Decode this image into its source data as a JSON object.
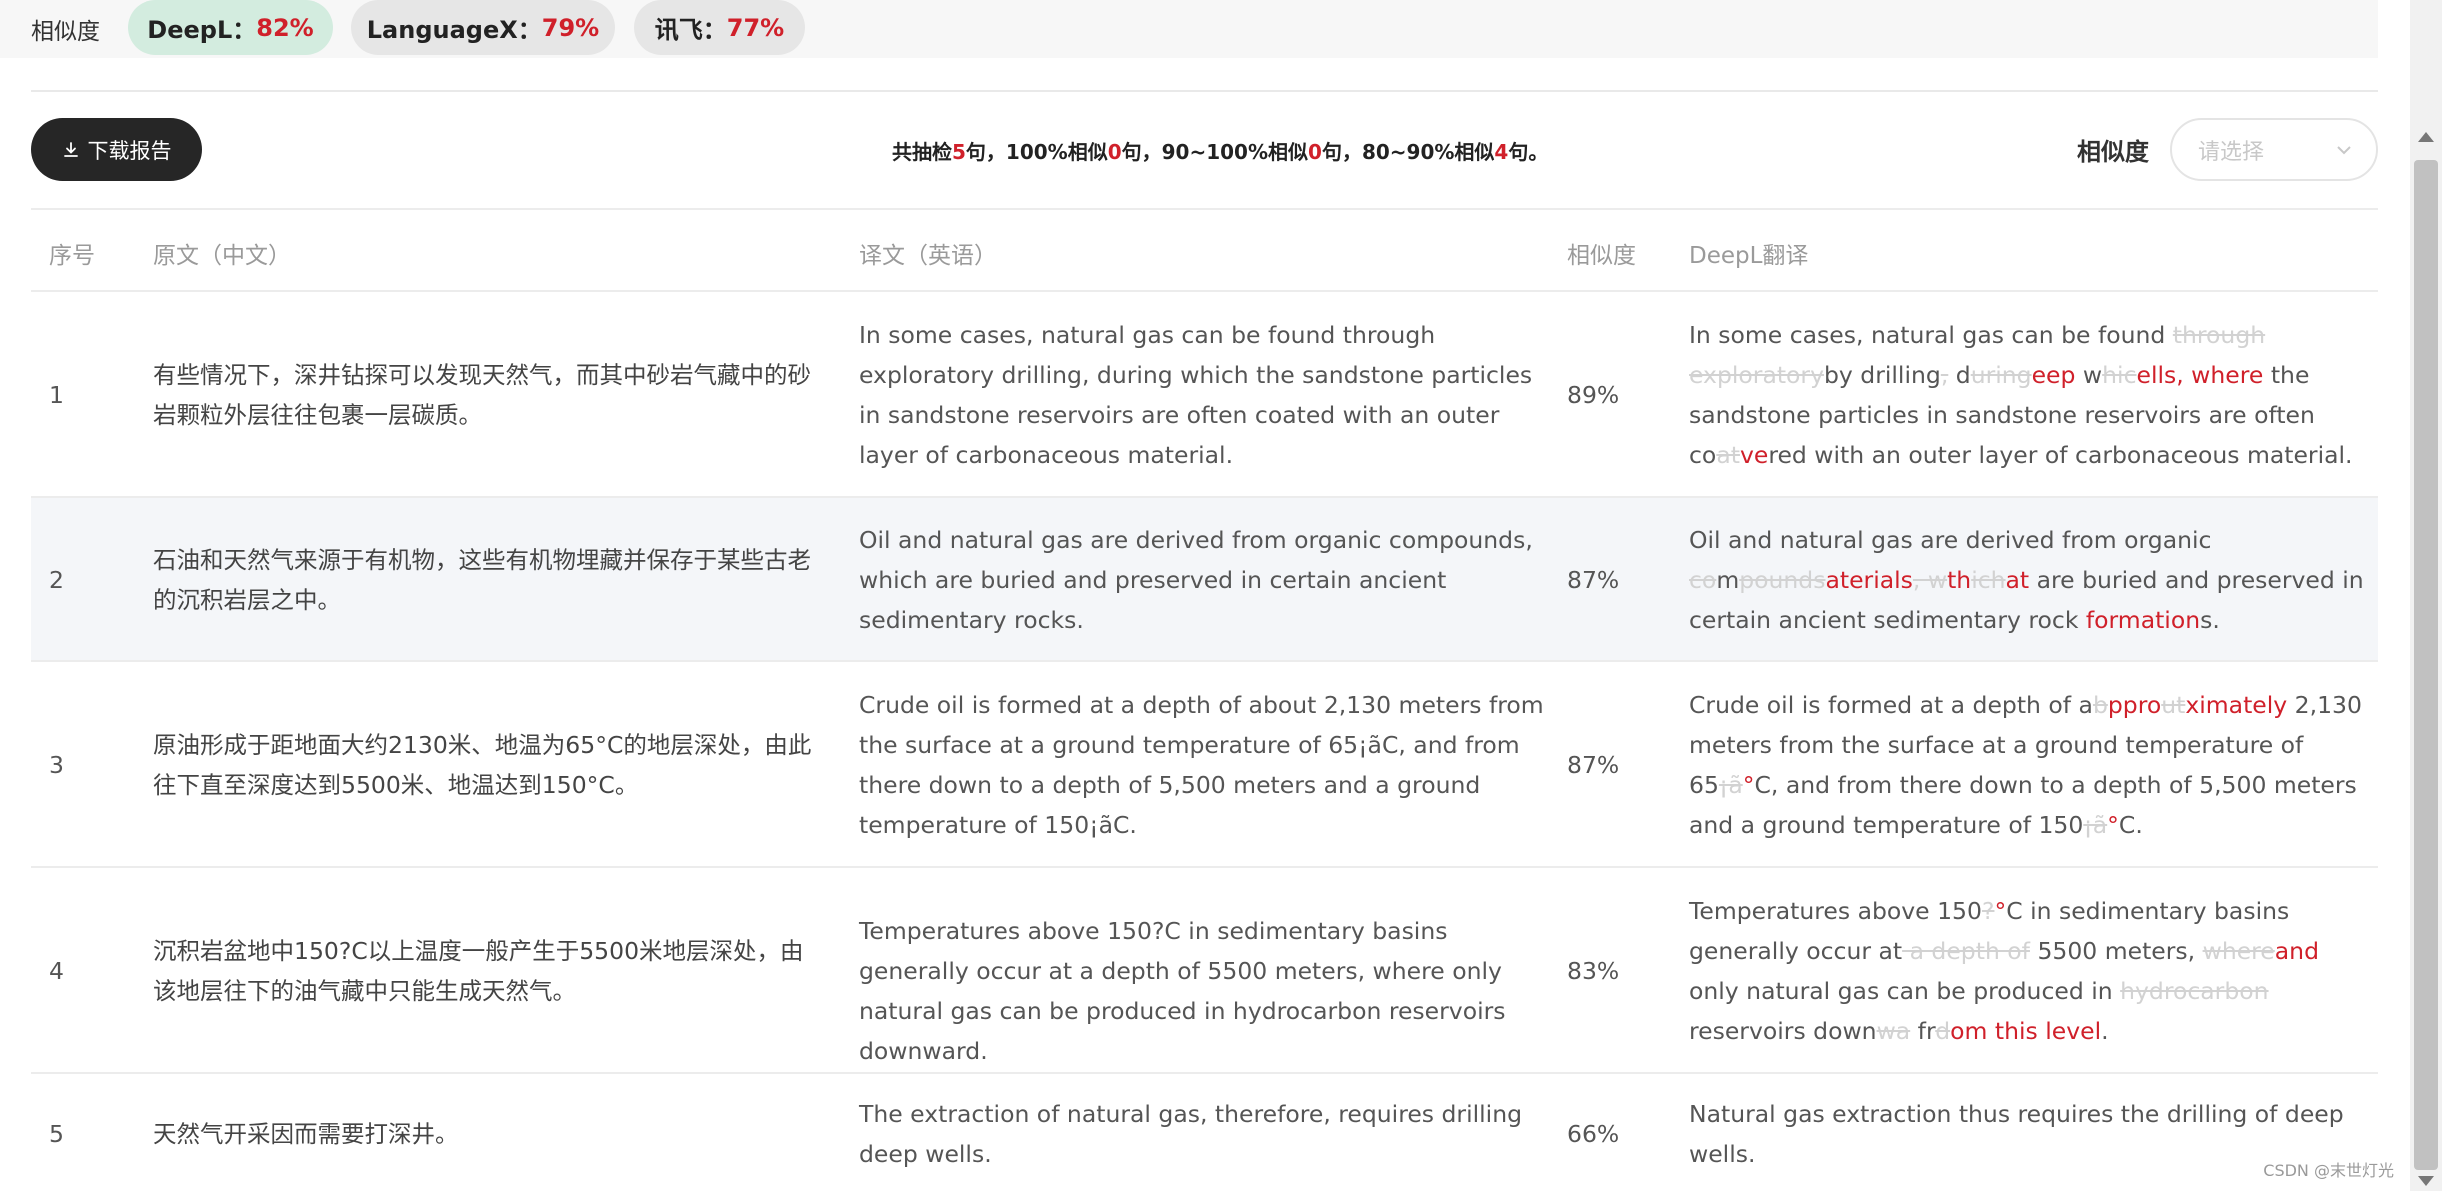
{
  "similarity_bar": {
    "label": "相似度",
    "items": [
      {
        "engine": "DeepL：",
        "value": "82%"
      },
      {
        "engine": "LanguageX：",
        "value": "79%"
      },
      {
        "engine": "讯飞：",
        "value": "77%"
      }
    ]
  },
  "toolbar": {
    "download_label": "下载报告",
    "summary": {
      "p1": "共抽检",
      "total": "5",
      "p2": "句，100%相似",
      "c100": "0",
      "p3": "句，90~100%相似",
      "c90": "0",
      "p4": "句，80~90%相似",
      "c80": "4",
      "p5": "句。"
    },
    "filter_label": "相似度",
    "filter_placeholder": "请选择"
  },
  "table": {
    "headers": {
      "num": "序号",
      "src": "原文（中文）",
      "tr": "译文（英语）",
      "sim": "相似度",
      "dl": "DeepL翻译"
    },
    "rows": [
      {
        "num": "1",
        "src": "有些情况下，深井钻探可以发现天然气，而其中砂岩气藏中的砂岩颗粒外层往往包裹一层碳质。",
        "tr": "In some cases, natural gas can be found through exploratory drilling, during which the sandstone particles in sandstone reservoirs are often coated with an outer layer of carbonaceous material.",
        "sim": "89%",
        "dl": [
          {
            "t": "In some cases, natural gas can be found ",
            "k": "n"
          },
          {
            "t": "through exploratory",
            "k": "d"
          },
          {
            "t": "by drilling",
            "k": "n"
          },
          {
            "t": ",",
            "k": "d"
          },
          {
            "t": " d",
            "k": "n"
          },
          {
            "t": "uring",
            "k": "d"
          },
          {
            "t": "eep",
            "k": "i"
          },
          {
            "t": " w",
            "k": "n"
          },
          {
            "t": "hic",
            "k": "d"
          },
          {
            "t": "ells, where",
            "k": "i"
          },
          {
            "t": " the sandstone particles in sandstone reservoirs are often co",
            "k": "n"
          },
          {
            "t": "at",
            "k": "d"
          },
          {
            "t": "ve",
            "k": "i"
          },
          {
            "t": "red with an outer layer of carbonaceous material.",
            "k": "n"
          }
        ]
      },
      {
        "num": "2",
        "src": "石油和天然气来源于有机物，这些有机物埋藏并保存于某些古老的沉积岩层之中。",
        "tr": "Oil and natural gas are derived from organic compounds, which are buried and preserved in certain ancient sedimentary rocks.",
        "sim": "87%",
        "dl": [
          {
            "t": "Oil and natural gas are derived from organic ",
            "k": "n"
          },
          {
            "t": "co",
            "k": "d"
          },
          {
            "t": "m",
            "k": "n"
          },
          {
            "t": "pounds",
            "k": "d"
          },
          {
            "t": "aterials",
            "k": "i"
          },
          {
            "t": ", w",
            "k": "d"
          },
          {
            "t": "th",
            "k": "i"
          },
          {
            "t": "ich",
            "k": "d"
          },
          {
            "t": "at",
            "k": "i"
          },
          {
            "t": " are buried and preserved in certain ancient sedimentary rock ",
            "k": "n"
          },
          {
            "t": "formation",
            "k": "i"
          },
          {
            "t": "s.",
            "k": "n"
          }
        ]
      },
      {
        "num": "3",
        "src": "原油形成于距地面大约2130米、地温为65°C的地层深处，由此往下直至深度达到5500米、地温达到150°C。",
        "tr": "Crude oil is formed at a depth of about 2,130 meters from the surface at a ground temperature of 65¡ãC, and from there down to a depth of 5,500 meters and a ground temperature of 150¡ãC.",
        "sim": "87%",
        "dl": [
          {
            "t": "Crude oil is formed at a depth of a",
            "k": "n"
          },
          {
            "t": "b",
            "k": "d"
          },
          {
            "t": "ppro",
            "k": "i"
          },
          {
            "t": "ut",
            "k": "d"
          },
          {
            "t": "ximately",
            "k": "i"
          },
          {
            "t": " 2,130 meters from the surface at a ground temperature of 65",
            "k": "n"
          },
          {
            "t": "¡ã",
            "k": "d"
          },
          {
            "t": "°",
            "k": "i"
          },
          {
            "t": "C, and from there down to a depth of 5,500 meters and a ground temperature of 150",
            "k": "n"
          },
          {
            "t": "¡ã",
            "k": "d"
          },
          {
            "t": "°",
            "k": "i"
          },
          {
            "t": "C.",
            "k": "n"
          }
        ]
      },
      {
        "num": "4",
        "src": "沉积岩盆地中150?C以上温度一般产生于5500米地层深处，由该地层往下的油气藏中只能生成天然气。",
        "tr": "Temperatures above 150?C in sedimentary basins generally occur at a depth of 5500 meters, where only natural gas can be produced in hydrocarbon reservoirs downward.",
        "sim": "83%",
        "dl": [
          {
            "t": "Temperatures above 150",
            "k": "n"
          },
          {
            "t": "?",
            "k": "d"
          },
          {
            "t": "°",
            "k": "i"
          },
          {
            "t": "C in sedimentary basins generally occur at",
            "k": "n"
          },
          {
            "t": " a depth of",
            "k": "d"
          },
          {
            "t": " 5500 meters, ",
            "k": "n"
          },
          {
            "t": "where",
            "k": "d"
          },
          {
            "t": "and",
            "k": "i"
          },
          {
            "t": " only natural gas can be produced in ",
            "k": "n"
          },
          {
            "t": "hydrocarbon ",
            "k": "d"
          },
          {
            "t": "reservoirs down",
            "k": "n"
          },
          {
            "t": "wa",
            "k": "d"
          },
          {
            "t": " fr",
            "k": "n"
          },
          {
            "t": "d",
            "k": "d"
          },
          {
            "t": "om this level",
            "k": "i"
          },
          {
            "t": ".",
            "k": "n"
          }
        ]
      },
      {
        "num": "5",
        "src": "天然气开采因而需要打深井。",
        "tr": "The extraction of natural gas, therefore, requires drilling deep wells.",
        "sim": "66%",
        "dl": [
          {
            "t": "Natural gas extraction thus requires the drilling of deep wells.",
            "k": "n"
          }
        ]
      }
    ]
  },
  "watermark": "CSDN @末世灯光",
  "colors": {
    "accent_red": "#d0202a",
    "deepl_pill": "#d3ecdf",
    "button_dark": "#262626",
    "deleted_gray": "#d2d2d2"
  }
}
